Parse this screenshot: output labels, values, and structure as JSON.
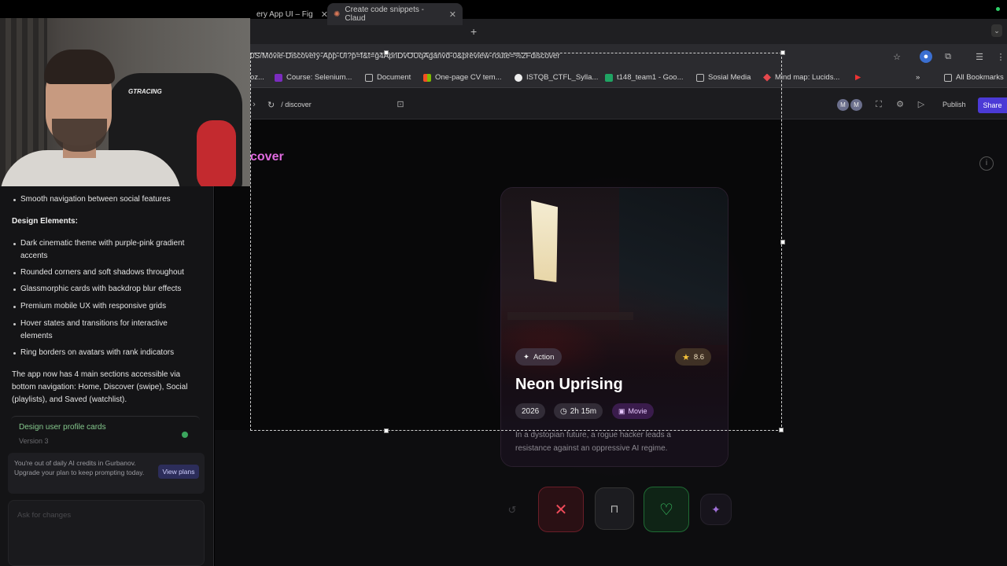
{
  "browser": {
    "tabs": [
      {
        "label": "ery App UI – Fig"
      },
      {
        "label": "Create code snippets - Claud"
      }
    ],
    "url": "0S/Movie-Discovery-App-UI?p=f&t=g4ApnDvOUqAganvd-0&preview-route=%2Fdiscover",
    "bookmarks": [
      {
        "label": "oz...",
        "icon": "bookmark-icon"
      },
      {
        "label": "Course: Selenium...",
        "icon": "purple-app-icon"
      },
      {
        "label": "Document",
        "icon": "folder-icon"
      },
      {
        "label": "One-page CV tem...",
        "icon": "microsoft-icon"
      },
      {
        "label": "ISTQB_CTFL_Sylla...",
        "icon": "github-icon"
      },
      {
        "label": "t148_team1 - Goo...",
        "icon": "sheets-icon"
      },
      {
        "label": "Sosial Media",
        "icon": "folder-icon"
      },
      {
        "label": "Mind map: Lucids...",
        "icon": "lucid-icon"
      }
    ],
    "all_bookmarks": "All Bookmarks",
    "new_tab": "+",
    "overflow": "»",
    "tab_menu": "⌄"
  },
  "toolbar": {
    "route": "/ discover",
    "avatars": [
      "M",
      "M"
    ],
    "publish": "Publish",
    "share": "Share"
  },
  "chat": {
    "items_top": [
      "Smooth navigation between social features"
    ],
    "design_heading": "Design Elements:",
    "design_items": [
      "Dark cinematic theme with purple-pink gradient accents",
      "Rounded corners and soft shadows throughout",
      "Glassmorphic cards with backdrop blur effects",
      "Premium mobile UX with responsive grids",
      "Hover states and transitions for interactive elements",
      "Ring borders on avatars with rank indicators"
    ],
    "summary": "The app now has 4 main sections accessible via bottom navigation: Home, Discover (swipe), Social (playlists), and Saved (watchlist).",
    "version_title": "Design user profile cards",
    "version_sub": "Version 3",
    "credits_text": "You're out of daily AI credits in Gurbanov. Upgrade your plan to keep prompting today.",
    "view_plans": "View plans",
    "ask_placeholder": "Ask for changes"
  },
  "preview": {
    "heading": "cover",
    "movie": {
      "genre": "Action",
      "rating": "8.6",
      "title": "Neon Uprising",
      "year": "2026",
      "duration": "2h 15m",
      "type": "Movie",
      "synopsis": "In a dystopian future, a rogue hacker leads a resistance against an oppressive AI regime."
    }
  },
  "webcam": {
    "chair_logo": "GTRACING"
  }
}
